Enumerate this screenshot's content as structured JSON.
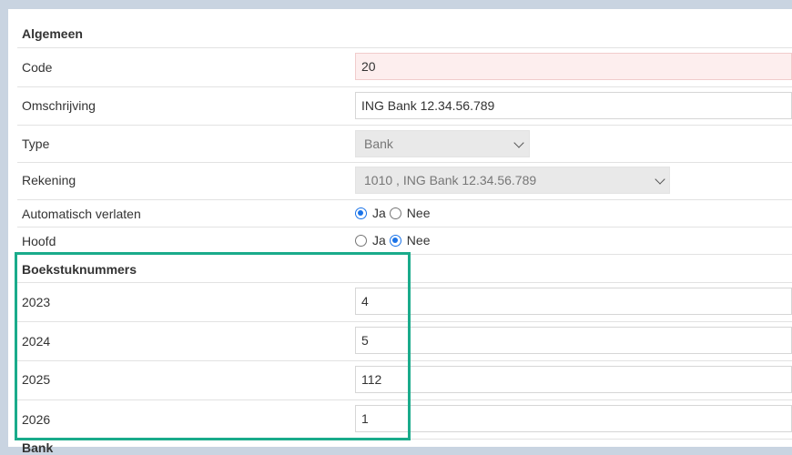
{
  "algemeen": {
    "section_title": "Algemeen",
    "code": {
      "label": "Code",
      "value": "20"
    },
    "omschrijving": {
      "label": "Omschrijving",
      "value": "ING Bank 12.34.56.789"
    },
    "type": {
      "label": "Type",
      "value": "Bank"
    },
    "rekening": {
      "label": "Rekening",
      "value": "1010 , ING Bank 12.34.56.789"
    },
    "automatisch_verlaten": {
      "label": "Automatisch verlaten",
      "yes": "Ja",
      "no": "Nee",
      "selected": "Ja"
    },
    "hoofd": {
      "label": "Hoofd",
      "yes": "Ja",
      "no": "Nee",
      "selected": "Nee"
    }
  },
  "boekstuknummers": {
    "section_title": "Boekstuknummers",
    "rows": [
      {
        "year": "2023",
        "value": "4"
      },
      {
        "year": "2024",
        "value": "5"
      },
      {
        "year": "2025",
        "value": "112"
      },
      {
        "year": "2026",
        "value": "1"
      }
    ]
  },
  "next_section": {
    "section_title": "Bank"
  },
  "colors": {
    "highlight": "#1aab8b",
    "error_field_bg": "#fdeeee",
    "radio_checked": "#1a73e8",
    "page_background": "#c9d4e1"
  }
}
